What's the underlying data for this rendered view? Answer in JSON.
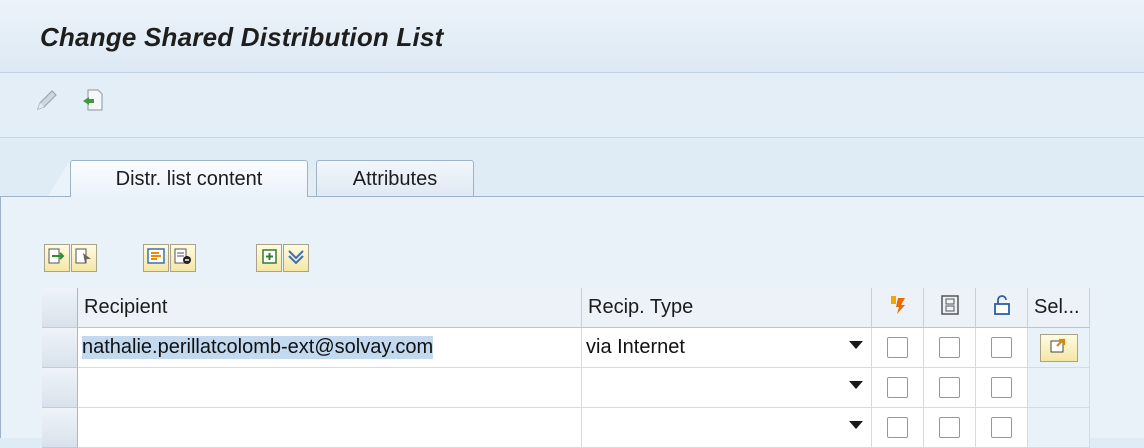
{
  "header": {
    "title": "Change Shared Distribution List"
  },
  "toolbar": {
    "icons": [
      "pencil-icon",
      "exit-document-icon"
    ]
  },
  "tabs": [
    {
      "label": "Distr. list content",
      "active": true
    },
    {
      "label": "Attributes",
      "active": false
    }
  ],
  "table_toolbar": {
    "icons": [
      "insert-row-icon",
      "select-row-icon",
      "copy-icon",
      "delete-row-icon",
      "details-icon",
      "filter-icon"
    ]
  },
  "table": {
    "columns": [
      "Recipient",
      "Recip. Type",
      "express-icon",
      "copy-icon",
      "lock-icon",
      "Sel..."
    ],
    "rows": [
      {
        "recipient": "nathalie.perillatcolomb-ext@solvay.com",
        "recip_type": "via Internet"
      },
      {
        "recipient": "",
        "recip_type": ""
      },
      {
        "recipient": "",
        "recip_type": ""
      }
    ]
  },
  "colors": {
    "accent": "#f0b000",
    "header_bg": "#dde9f4"
  }
}
